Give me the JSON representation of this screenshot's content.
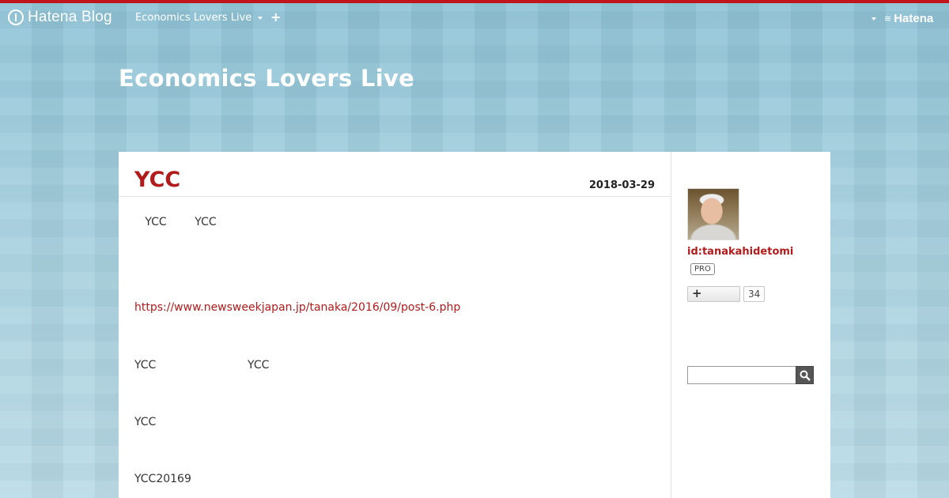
{
  "topbar": {
    "logo_text": "Hatena Blog",
    "blog_menu_label": "Economics Lovers Live",
    "add_label": "+",
    "brand": "Hatena"
  },
  "blog": {
    "title": "Economics Lovers Live"
  },
  "entry": {
    "title": "YCC",
    "date": "2018-03-29",
    "paragraphs": [
      "   YCC        YCC",
      "YCC                          YCC",
      "YCC",
      "YCC20169"
    ],
    "link": "https://www.newsweekjapan.jp/tanaka/2016/09/post-6.php"
  },
  "sidebar": {
    "user_id": "id:tanakahidetomi",
    "pro_badge": "PRO",
    "subscribe_icon": "plus-icon",
    "subscriber_count": "34",
    "search": {
      "placeholder": "",
      "button_icon": "magnifier-icon"
    }
  },
  "colors": {
    "accent": "#c0151a",
    "title_red": "#b11b1b"
  }
}
